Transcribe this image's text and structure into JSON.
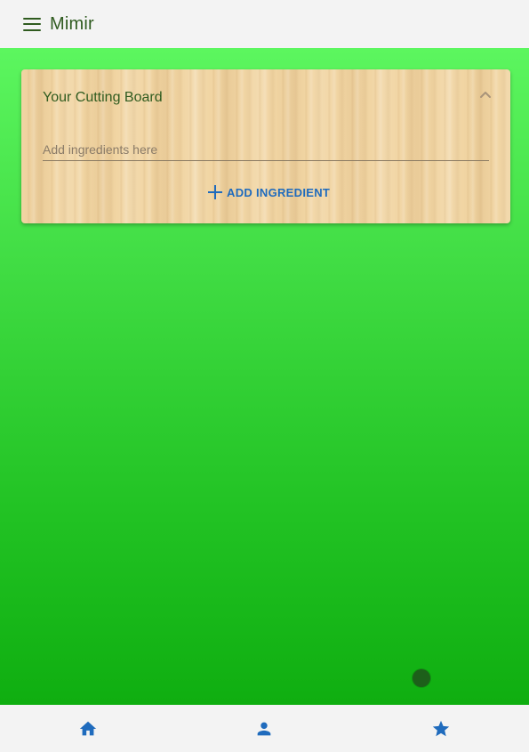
{
  "app": {
    "title": "Mimir",
    "menu_icon": "hamburger-menu-icon"
  },
  "colors": {
    "appbar_bg": "#f3f3f3",
    "title_text": "#2f5b1f",
    "gradient_top": "#5cf65f",
    "gradient_bottom": "#0fae10",
    "card_wood": "#f1d5a3",
    "accent_blue": "#1f6bbd",
    "fab_dot": "#1d5f1a"
  },
  "cutting_board": {
    "title": "Your Cutting Board",
    "collapse_icon": "chevron-up-icon",
    "input": {
      "placeholder": "Add ingredients here",
      "value": ""
    },
    "add_button": {
      "label": "ADD INGREDIENT",
      "icon": "plus-icon"
    }
  },
  "bottom_nav": {
    "items": [
      {
        "name": "home",
        "icon": "home-icon"
      },
      {
        "name": "profile",
        "icon": "person-icon"
      },
      {
        "name": "favorites",
        "icon": "star-icon"
      }
    ]
  }
}
